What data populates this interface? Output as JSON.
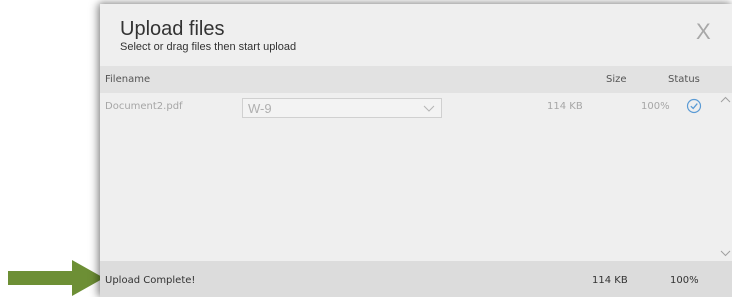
{
  "dialog": {
    "title": "Upload files",
    "subtitle": "Select or drag files then start upload",
    "close_label": "X"
  },
  "columns": {
    "filename": "Filename",
    "size": "Size",
    "status": "Status"
  },
  "files": [
    {
      "filename": "Document2.pdf",
      "document_type": "W-9",
      "size": "114 KB",
      "progress": "100%",
      "status_icon": "check-circle-icon"
    }
  ],
  "footer": {
    "status_text": "Upload Complete!",
    "total_size": "114 KB",
    "total_progress": "100%"
  },
  "colors": {
    "arrow": "#6d8f35",
    "check": "#5b9bd5"
  }
}
